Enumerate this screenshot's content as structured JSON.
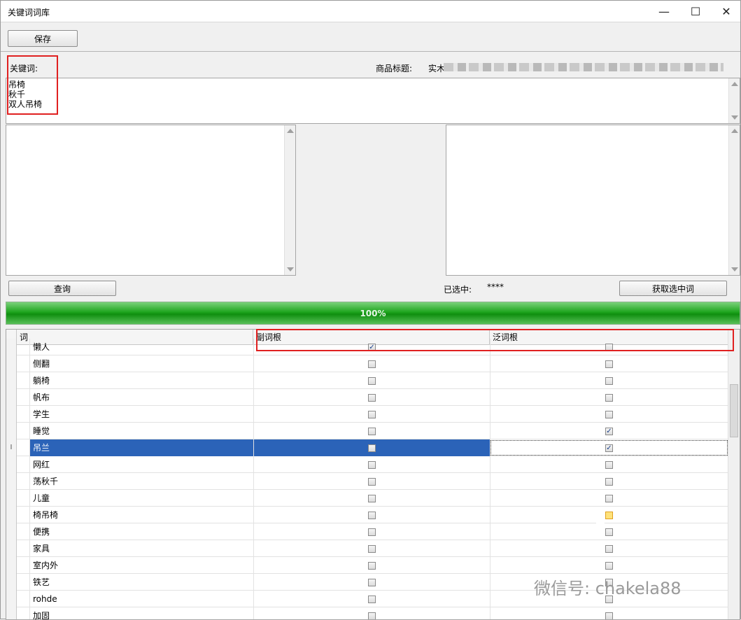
{
  "window": {
    "title": "关键词词库",
    "minimize_glyph": "—",
    "maximize_glyph": "☐",
    "close_glyph": "✕"
  },
  "toolbar": {
    "save_label": "保存"
  },
  "keyword_section": {
    "label": "关键词:",
    "product_title_label": "商品标题:",
    "product_title_value": "实木",
    "keywords_text": "吊椅\n秋千\n双人吊椅"
  },
  "actions": {
    "query_label": "查询",
    "selected_label": "已选中:",
    "selected_value": "****",
    "get_selected_label": "获取选中词"
  },
  "progress": {
    "value": 100,
    "text": "100%"
  },
  "table": {
    "columns": [
      "词",
      "副词根",
      "泛词根"
    ],
    "rows": [
      {
        "word": "懒人",
        "sub": true,
        "gen": false
      },
      {
        "word": "侧翻",
        "sub": false,
        "gen": false
      },
      {
        "word": "躺椅",
        "sub": false,
        "gen": false
      },
      {
        "word": "帆布",
        "sub": false,
        "gen": false
      },
      {
        "word": "学生",
        "sub": false,
        "gen": false
      },
      {
        "word": "睡觉",
        "sub": false,
        "gen": true
      },
      {
        "word": "吊兰",
        "sub": false,
        "gen": true,
        "selected": true
      },
      {
        "word": "网红",
        "sub": false,
        "gen": false
      },
      {
        "word": "荡秋千",
        "sub": false,
        "gen": false
      },
      {
        "word": "儿童",
        "sub": false,
        "gen": false
      },
      {
        "word": "椅吊椅",
        "sub": false,
        "gen": false,
        "gen_hover": true
      },
      {
        "word": "便携",
        "sub": false,
        "gen": false
      },
      {
        "word": "家具",
        "sub": false,
        "gen": false
      },
      {
        "word": "室内外",
        "sub": false,
        "gen": false
      },
      {
        "word": "铁艺",
        "sub": false,
        "gen": false
      },
      {
        "word": "rohde",
        "sub": false,
        "gen": false
      },
      {
        "word": "加固",
        "sub": false,
        "gen": false
      }
    ],
    "selected_row_marker": "I",
    "check_glyph": "✓"
  },
  "watermark": {
    "text": "微信号: chakela88"
  }
}
